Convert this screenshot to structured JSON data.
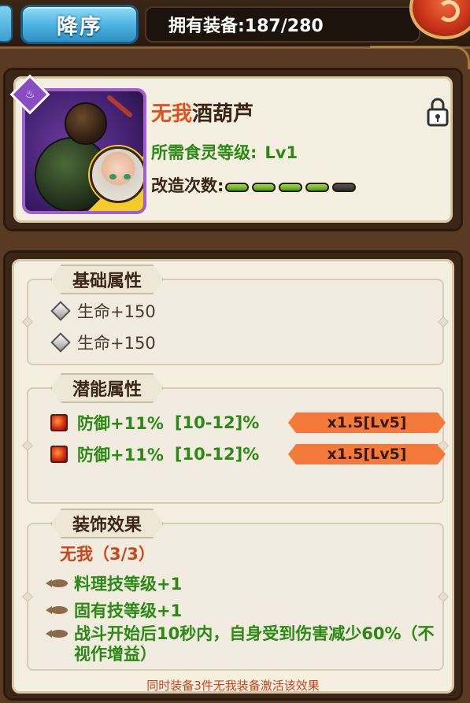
{
  "topbar": {
    "sort_label": "降序",
    "equip_count_label": "拥有装备:187/280"
  },
  "card": {
    "name_set": "无我",
    "name_item": "酒葫芦",
    "req_level_label": "所需食灵等级:",
    "req_level_value": "Lv1",
    "refine_label": "改造次数:",
    "refine_filled": 4,
    "refine_total": 5,
    "rarity_icon": "food-dish-icon",
    "lock_icon": "lock-icon"
  },
  "base_attrs": {
    "title": "基础属性",
    "rows": [
      "生命+150",
      "生命+150"
    ]
  },
  "potential_attrs": {
    "title": "潜能属性",
    "rows": [
      {
        "stat": "防御+11%",
        "range": "[10-12]%",
        "mult": "x1.5[Lv5]"
      },
      {
        "stat": "防御+11%",
        "range": "[10-12]%",
        "mult": "x1.5[Lv5]"
      }
    ]
  },
  "decor_effect": {
    "title": "装饰效果",
    "set_name": "无我（3/3）",
    "effects": [
      "料理技等级+1",
      "固有技等级+1",
      "战斗开始后10秒内，自身受到伤害减少60%（不视作增益）"
    ],
    "footer": "同时装备3件无我装备激活该效果"
  },
  "colors": {
    "accent_blue": "#4bb0df",
    "set_orange": "#e0521e",
    "green_text": "#2b8a14",
    "multiplier_bg": "#f47a3c"
  }
}
